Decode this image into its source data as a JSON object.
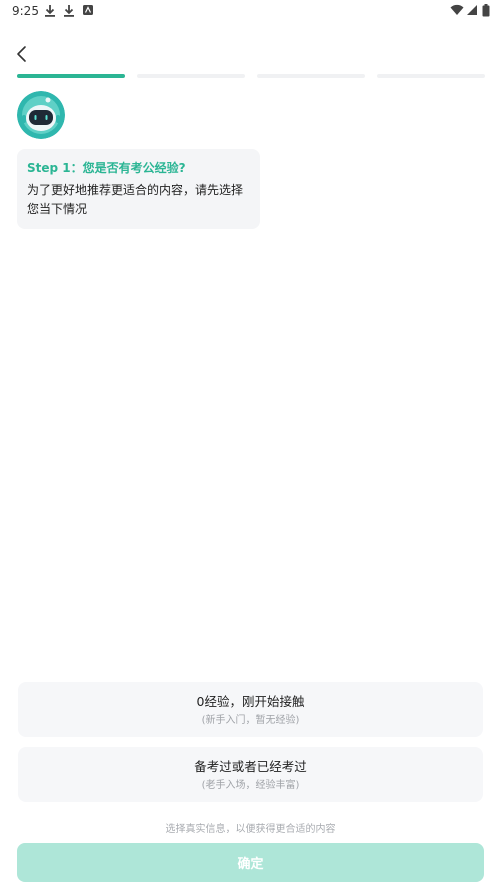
{
  "status_bar": {
    "time": "9:25",
    "icons": [
      "download-icon",
      "download-icon",
      "notification-icon",
      "wifi-icon",
      "signal-icon",
      "battery-icon"
    ]
  },
  "nav": {
    "back_icon": "chevron-left-icon"
  },
  "progress": {
    "total_steps": 4,
    "current_step": 1,
    "active_color": "#2bb594",
    "inactive_color": "#f0f1f3"
  },
  "bot": {
    "avatar_icon": "robot-avatar-icon",
    "step_title": "Step 1：您是否有考公经验?",
    "message": "为了更好地推荐更适合的内容，请先选择您当下情况"
  },
  "options": [
    {
      "title": "0经验，刚开始接触",
      "subtitle": "(新手入门，暂无经验)"
    },
    {
      "title": "备考过或者已经考过",
      "subtitle": "(老手入场，经验丰富)"
    }
  ],
  "hint": "选择真实信息，以便获得更合适的内容",
  "confirm": {
    "label": "确定",
    "color": "#aee6d8"
  }
}
